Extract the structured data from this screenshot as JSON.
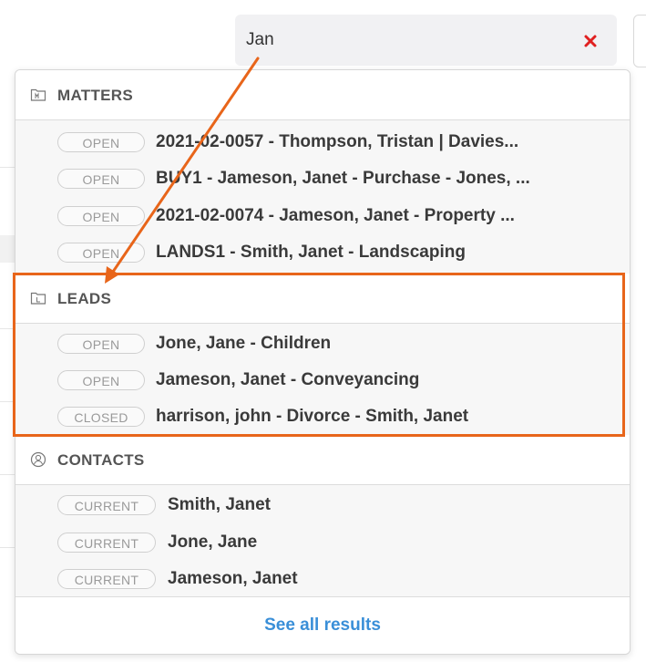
{
  "search": {
    "value": "Jan",
    "placeholder": ""
  },
  "colors": {
    "accent_link": "#3a8fd8",
    "annotation": "#e8651a",
    "clear_icon": "#e02020"
  },
  "sections": {
    "matters": {
      "label": "MATTERS",
      "icon": "folder-m-icon",
      "rows": [
        {
          "status": "OPEN",
          "text": "2021-02-0057 - Thompson, Tristan | Davies..."
        },
        {
          "status": "OPEN",
          "text": "BUY1 - Jameson, Janet - Purchase - Jones, ..."
        },
        {
          "status": "OPEN",
          "text": "2021-02-0074 - Jameson, Janet - Property ..."
        },
        {
          "status": "OPEN",
          "text": "LANDS1 - Smith, Janet - Landscaping"
        }
      ]
    },
    "leads": {
      "label": "LEADS",
      "icon": "folder-l-icon",
      "rows": [
        {
          "status": "OPEN",
          "text": "Jone, Jane - Children"
        },
        {
          "status": "OPEN",
          "text": "Jameson, Janet - Conveyancing"
        },
        {
          "status": "CLOSED",
          "text": "harrison, john - Divorce - Smith, Janet"
        }
      ]
    },
    "contacts": {
      "label": "CONTACTS",
      "icon": "contact-icon",
      "rows": [
        {
          "status": "CURRENT",
          "text": "Smith, Janet"
        },
        {
          "status": "CURRENT",
          "text": "Jone, Jane"
        },
        {
          "status": "CURRENT",
          "text": "Jameson, Janet"
        }
      ]
    }
  },
  "footer": {
    "see_all_label": "See all results"
  }
}
